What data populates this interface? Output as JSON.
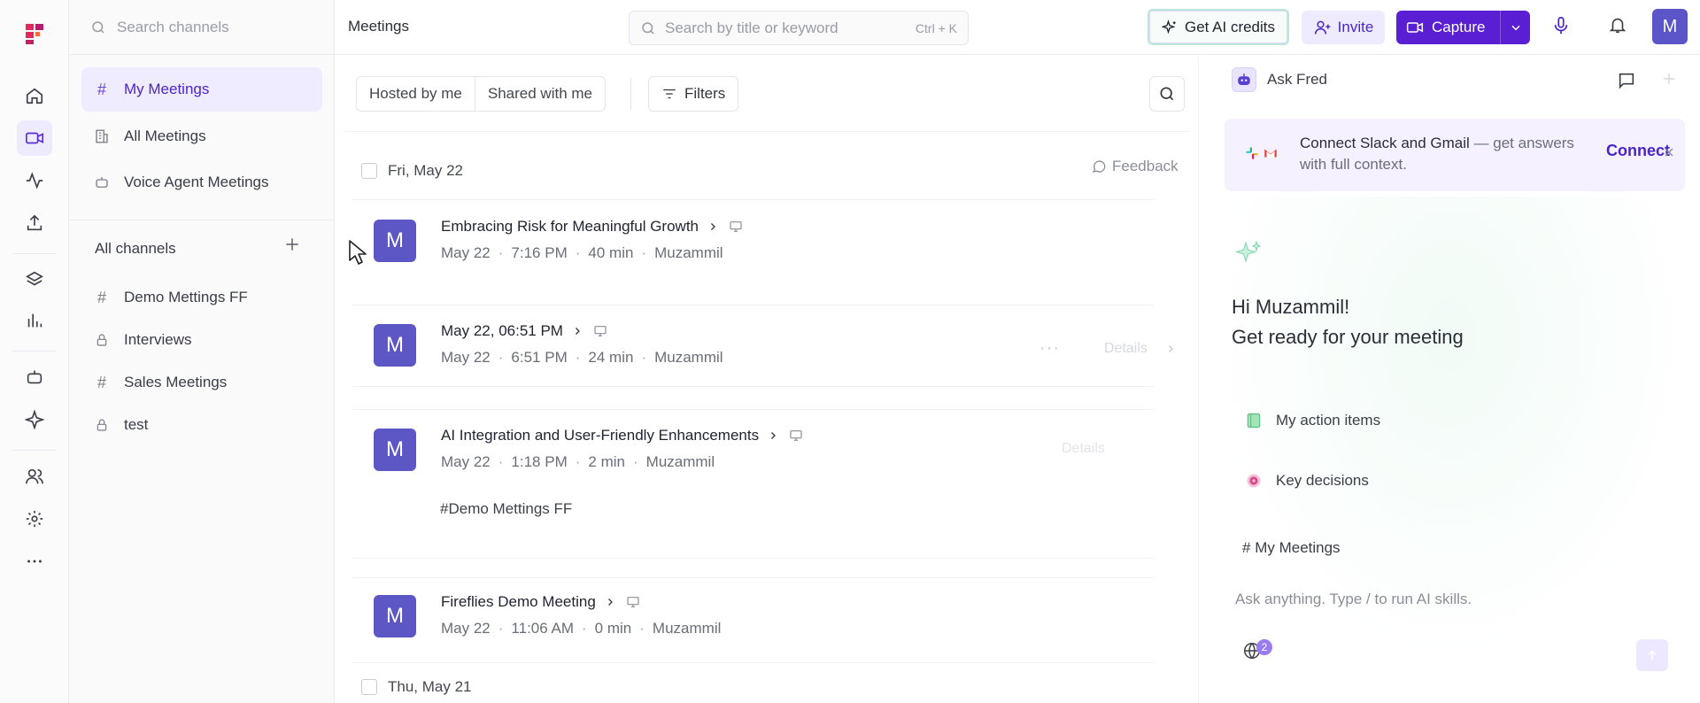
{
  "sidebar": {
    "search_placeholder": "Search channels",
    "nav": [
      {
        "label": "My Meetings"
      },
      {
        "label": "All Meetings"
      },
      {
        "label": "Voice Agent Meetings"
      }
    ],
    "channels_header": "All channels",
    "channels": [
      {
        "label": "Demo Mettings FF",
        "type": "public"
      },
      {
        "label": "Interviews",
        "type": "private"
      },
      {
        "label": "Sales Meetings",
        "type": "public"
      },
      {
        "label": "test",
        "type": "private"
      }
    ]
  },
  "header": {
    "title": "Meetings",
    "search_placeholder": "Search by title or keyword",
    "search_shortcut": "Ctrl + K",
    "credits_label": "Get AI credits",
    "invite_label": "Invite",
    "capture_label": "Capture",
    "avatar_initial": "M"
  },
  "toolbar": {
    "hosted_label": "Hosted by me",
    "shared_label": "Shared with me",
    "filters_label": "Filters"
  },
  "list": {
    "feedback_label": "Feedback",
    "groups": [
      {
        "date": "Fri, May 22",
        "meetings": [
          {
            "initial": "M",
            "title": "Embracing Risk for Meaningful Growth",
            "date": "May 22",
            "time": "7:16 PM",
            "duration": "40 min",
            "host": "Muzammil",
            "tag": ""
          },
          {
            "initial": "M",
            "title": "May 22, 06:51 PM",
            "date": "May 22",
            "time": "6:51 PM",
            "duration": "24 min",
            "host": "Muzammil",
            "tag": "",
            "details_label": "Details"
          },
          {
            "initial": "M",
            "title": "AI Integration and User-Friendly Enhancements",
            "date": "May 22",
            "time": "1:18 PM",
            "duration": "2 min",
            "host": "Muzammil",
            "tag": "Demo Mettings FF",
            "details_label": "Details"
          },
          {
            "initial": "M",
            "title": "Fireflies Demo Meeting",
            "date": "May 22",
            "time": "11:06 AM",
            "duration": "0 min",
            "host": "Muzammil",
            "tag": ""
          }
        ]
      },
      {
        "date": "Thu, May 21",
        "meetings": []
      }
    ]
  },
  "panel": {
    "title": "Ask Fred",
    "connect_title": "Connect Slack and Gmail",
    "connect_desc": " — get answers with full context.",
    "connect_button": "Connect",
    "greeting_line1": "Hi Muzammil!",
    "greeting_line2": "Get ready for your meeting",
    "suggestions": [
      {
        "label": "My action items"
      },
      {
        "label": "Key decisions"
      }
    ],
    "channel_chip": "My Meetings",
    "input_placeholder": "Ask anything. Type / to run AI skills.",
    "globe_badge": "2"
  },
  "colors": {
    "accent": "#5a1fd2",
    "accent_light": "#efebff",
    "avatar_bg": "#5d57c6"
  }
}
